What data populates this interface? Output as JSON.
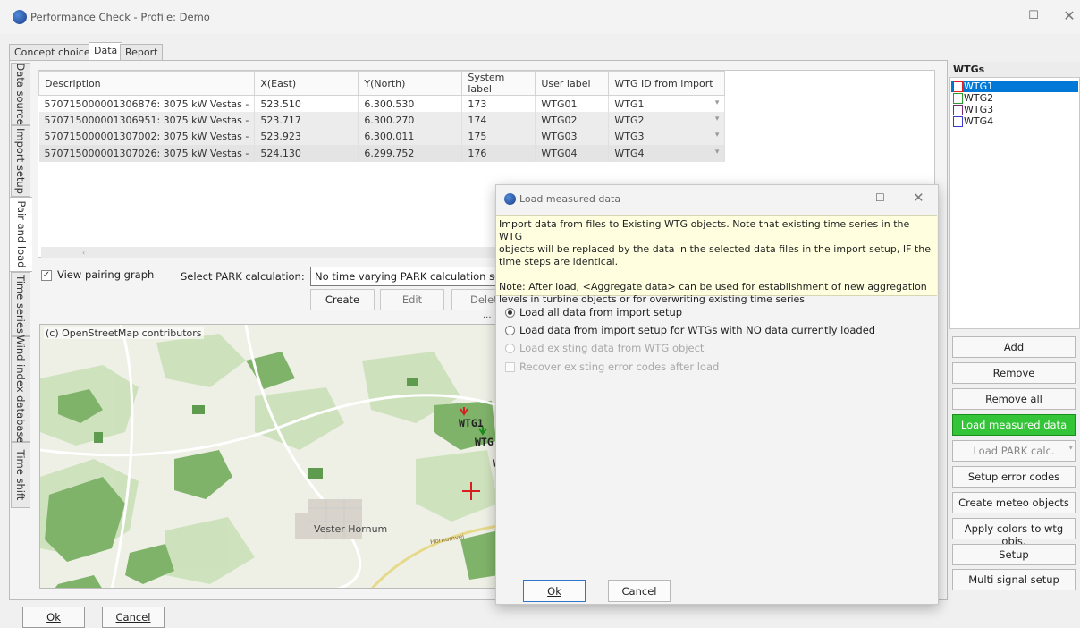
{
  "window": {
    "title": "Performance Check - Profile: Demo",
    "maximize_glyph": "☐",
    "close_glyph": "✕"
  },
  "tabs": [
    "Concept choice",
    "Data",
    "Report"
  ],
  "side_tabs": [
    "Data source",
    "Import setup",
    "Pair and load",
    "Time series",
    "Wind index database",
    "Time shift"
  ],
  "grid": {
    "columns": [
      "Description",
      "X(East)",
      "Y(North)",
      "System label",
      "User label",
      "WTG ID from import"
    ],
    "rows": [
      {
        "description": "570715000001306876: 3075 kW Vestas -",
        "x": "523.510",
        "y": "6.300.530",
        "system_label": "173",
        "user_label": "WTG01",
        "wtg_id": "WTG1"
      },
      {
        "description": "570715000001306951: 3075 kW Vestas -",
        "x": "523.717",
        "y": "6.300.270",
        "system_label": "174",
        "user_label": "WTG02",
        "wtg_id": "WTG2"
      },
      {
        "description": "570715000001307002: 3075 kW Vestas -",
        "x": "523.923",
        "y": "6.300.011",
        "system_label": "175",
        "user_label": "WTG03",
        "wtg_id": "WTG3"
      },
      {
        "description": "570715000001307026: 3075 kW Vestas -",
        "x": "524.130",
        "y": "6.299.752",
        "system_label": "176",
        "user_label": "WTG04",
        "wtg_id": "WTG4"
      }
    ]
  },
  "controls": {
    "view_pairing_label": "View pairing graph",
    "view_pairing_checked": true,
    "select_park_label": "Select PARK calculation:",
    "park_select_value": "No time varying PARK calculation selec",
    "create_label": "Create",
    "edit_label": "Edit",
    "delete_label": "Delet",
    "ellipsis": "..."
  },
  "map": {
    "attribution": "(c) OpenStreetMap contributors",
    "town": "Vester Hornum",
    "road": "Hornumvej",
    "turbine_labels": [
      "WTG1",
      "WTG",
      "W"
    ]
  },
  "wtgs_panel": {
    "title": "WTGs",
    "items": [
      {
        "label": "WTG1",
        "color": "#e02020",
        "selected": true
      },
      {
        "label": "WTG2",
        "color": "#2a9a2a",
        "selected": false
      },
      {
        "label": "WTG3",
        "color": "#7a2a7a",
        "selected": false
      },
      {
        "label": "WTG4",
        "color": "#3a3ad0",
        "selected": false
      }
    ],
    "buttons": [
      "Add",
      "Remove",
      "Remove all",
      "Load measured data",
      "Load PARK calc.",
      "Setup error codes",
      "Create meteo objects",
      "Apply colors to wtg objs.",
      "Setup",
      "Multi signal setup"
    ],
    "load_measured_color": "#34c437"
  },
  "footer": {
    "ok_label": "Ok",
    "cancel_label": "Cancel"
  },
  "dialog": {
    "title": "Load measured data",
    "info_lines": [
      "Import data from files to Existing WTG objects. Note that existing time series in the WTG",
      "objects will be replaced by the data in the selected data files in the import setup, IF the",
      "time steps are identical.",
      "",
      "Note: After load, <Aggregate data> can be used for establishment of new aggregation",
      "levels in turbine objects or for overwriting existing time series"
    ],
    "options": [
      {
        "label": "Load all data from import setup",
        "selected": true,
        "enabled": true
      },
      {
        "label": "Load data from import setup for WTGs with NO data currently loaded",
        "selected": false,
        "enabled": true
      },
      {
        "label": "Load existing data from WTG object",
        "selected": false,
        "enabled": false
      }
    ],
    "recover_label": "Recover existing error codes after load",
    "ok_label": "Ok",
    "cancel_label": "Cancel"
  }
}
